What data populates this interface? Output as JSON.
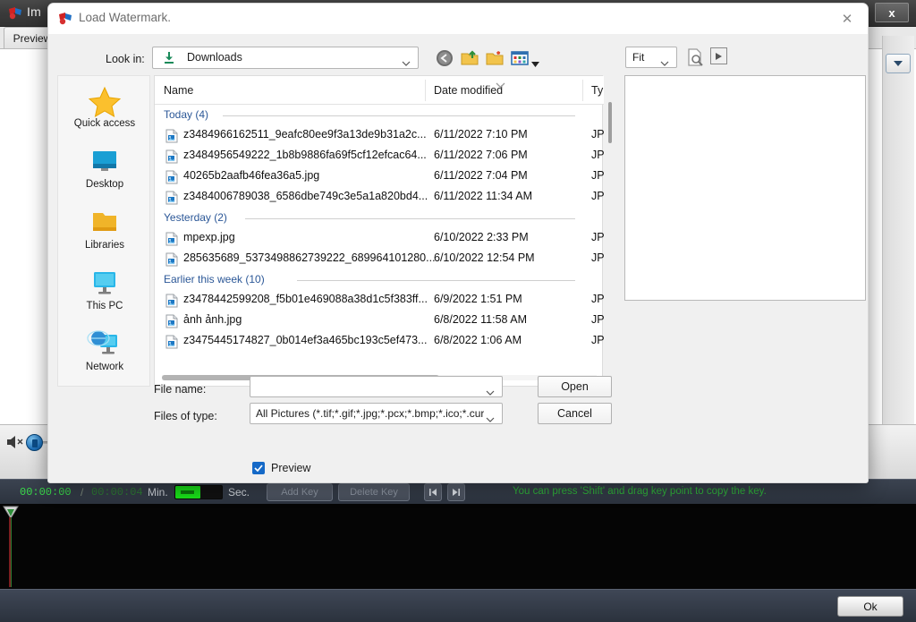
{
  "app": {
    "title": "Im",
    "tab_label": "Preview",
    "close_label": "x",
    "icon": "app-logo-icon",
    "volume_icon": "speaker-mute-icon",
    "scroll_up_icon": "chevron-down-icon",
    "scroll_down_icon": "arrow-down-icon"
  },
  "timeline": {
    "current_time": "00:00:00",
    "separator": "/",
    "total_time": "00:00:04",
    "min_label": "Min.",
    "sec_label": "Sec.",
    "add_key_label": "Add Key",
    "delete_key_label": "Delete Key",
    "prev_key_icon": "skip-previous-icon",
    "next_key_icon": "skip-next-icon",
    "hint": "You can press 'Shift' and drag key point to copy the key."
  },
  "footer": {
    "ok_label": "Ok"
  },
  "dialog": {
    "title": "Load Watermark.",
    "icon": "app-logo-icon",
    "close_icon": "close-icon",
    "look_in": {
      "label": "Look in:",
      "value": "Downloads",
      "icon": "downloads-icon",
      "chevron": "chevron-down-icon"
    },
    "toolbar": {
      "back_icon": "back-arrow-icon",
      "up_icon": "up-folder-icon",
      "new_folder_icon": "new-folder-icon",
      "view_icon": "view-mode-icon",
      "view_arrow_icon": "chevron-down-icon"
    },
    "preview_toolbar": {
      "zoom_mode": "Fit",
      "zoom_chevron": "chevron-down-icon",
      "preview_icon": "page-zoom-icon",
      "play_icon": "play-icon"
    },
    "places": [
      {
        "label": "Quick access",
        "icon": "star-icon"
      },
      {
        "label": "Desktop",
        "icon": "desktop-icon"
      },
      {
        "label": "Libraries",
        "icon": "folder-icon"
      },
      {
        "label": "This PC",
        "icon": "computer-icon"
      },
      {
        "label": "Network",
        "icon": "network-icon"
      }
    ],
    "file_list": {
      "columns": [
        "Name",
        "Date modified",
        "Ty"
      ],
      "sort_indicator_icon": "sort-chevron-icon",
      "groups": [
        {
          "label": "Today (4)",
          "rows": [
            {
              "name": "z3484966162511_9eafc80ee9f3a13de9b31a2c...",
              "date": "6/11/2022 7:10 PM",
              "type": "JP",
              "icon": "image-file-icon"
            },
            {
              "name": "z3484956549222_1b8b9886fa69f5cf12efcac64...",
              "date": "6/11/2022 7:06 PM",
              "type": "JP",
              "icon": "image-file-icon"
            },
            {
              "name": "40265b2aafb46fea36a5.jpg",
              "date": "6/11/2022 7:04 PM",
              "type": "JP",
              "icon": "image-file-icon"
            },
            {
              "name": "z3484006789038_6586dbe749c3e5a1a820bd4...",
              "date": "6/11/2022 11:34 AM",
              "type": "JP",
              "icon": "image-file-icon"
            }
          ]
        },
        {
          "label": "Yesterday (2)",
          "rows": [
            {
              "name": "mpexp.jpg",
              "date": "6/10/2022 2:33 PM",
              "type": "JP",
              "icon": "image-file-icon"
            },
            {
              "name": "285635689_5373498862739222_689964101280...",
              "date": "6/10/2022 12:54 PM",
              "type": "JP",
              "icon": "image-file-icon"
            }
          ]
        },
        {
          "label": "Earlier this week (10)",
          "rows": [
            {
              "name": "z3478442599208_f5b01e469088a38d1c5f383ff...",
              "date": "6/9/2022 1:51 PM",
              "type": "JP",
              "icon": "image-file-icon"
            },
            {
              "name": "ảnh ảnh.jpg",
              "date": "6/8/2022 11:58 AM",
              "type": "JP",
              "icon": "image-file-icon"
            },
            {
              "name": "z3475445174827_0b014ef3a465bc193c5ef473...",
              "date": "6/8/2022 1:06 AM",
              "type": "JP",
              "icon": "image-file-icon"
            }
          ]
        }
      ]
    },
    "file_name": {
      "label": "File name:",
      "value": "",
      "chevron": "chevron-down-icon"
    },
    "files_of_type": {
      "label": "Files of type:",
      "value": "All Pictures (*.tif;*.gif;*.jpg;*.pcx;*.bmp;*.ico;*.cur",
      "chevron": "chevron-down-icon"
    },
    "buttons": {
      "open": "Open",
      "cancel": "Cancel"
    },
    "preview_checkbox": {
      "label": "Preview",
      "checked": true
    }
  }
}
